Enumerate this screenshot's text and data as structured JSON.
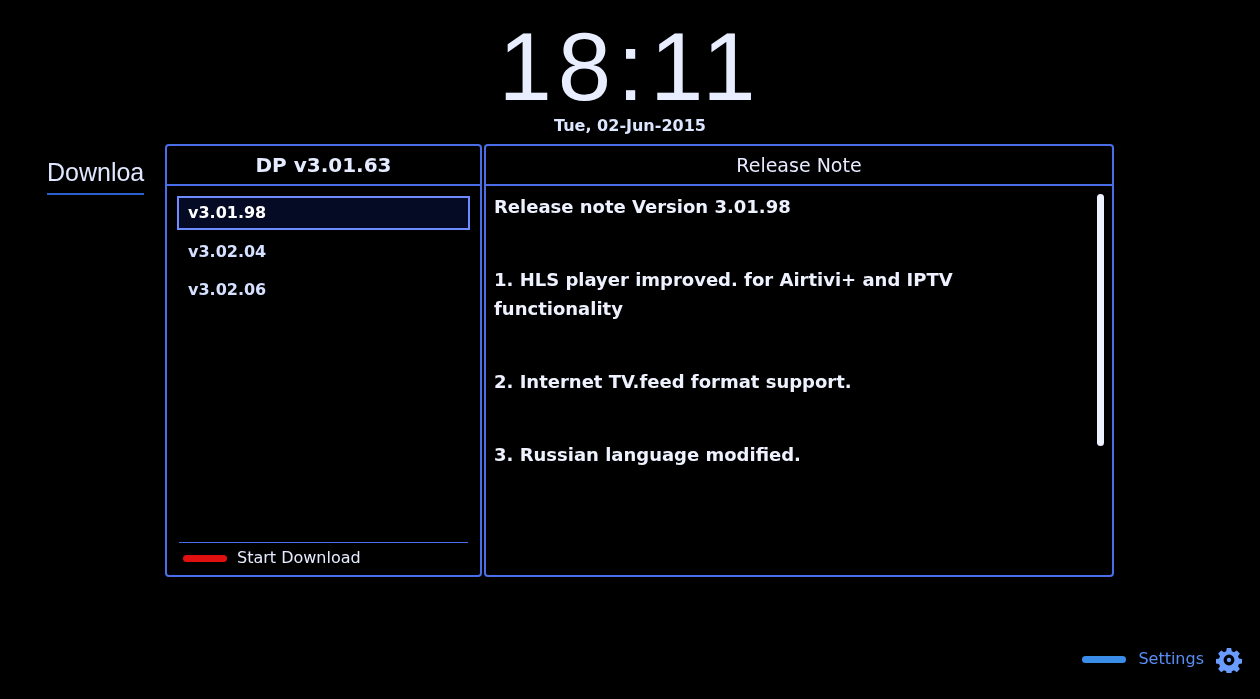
{
  "clock": {
    "time": "18:11",
    "date": "Tue, 02-Jun-2015"
  },
  "page_title": "Downloa",
  "versions_panel": {
    "title": "DP v3.01.63",
    "items": [
      {
        "label": "v3.01.98",
        "selected": true
      },
      {
        "label": "v3.02.04",
        "selected": false
      },
      {
        "label": "v3.02.06",
        "selected": false
      }
    ],
    "key_hint": {
      "label": "Start Download",
      "color": "#e01010"
    }
  },
  "release_note": {
    "title": "Release Note",
    "lines": [
      "Release note Version 3.01.98",
      "1. HLS player improved. for Airtivi+ and IPTV functionality",
      "2. Internet TV.feed format support.",
      "3. Russian language modified."
    ]
  },
  "footer": {
    "key_hint": {
      "label": "Settings",
      "color": "#3a8ee8"
    }
  }
}
